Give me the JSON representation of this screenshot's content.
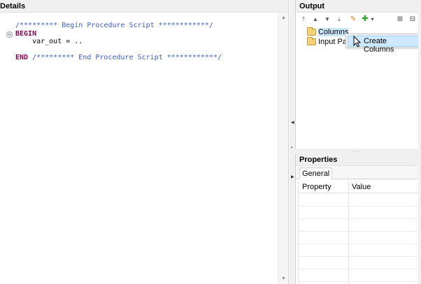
{
  "details": {
    "title": "Details",
    "code": {
      "line1": "/********* Begin Procedure Script ************/",
      "line2": "BEGIN",
      "line3": "    var_out = ..",
      "line5_keyword": "END",
      "line5_comment": " /********* End Procedure Script ************/"
    },
    "fold_marker": "⊖"
  },
  "output": {
    "title": "Output",
    "toolbar": {
      "top": "⤒",
      "up": "▲",
      "down": "▼",
      "bottom": "⤓",
      "edit": "✎",
      "add": "✚",
      "add_dropdown": "▾",
      "expand_all": "⊞",
      "collapse_all": "⊟"
    },
    "tree": [
      {
        "label": "Columns",
        "icon": "folder-open-icon",
        "selected": true
      },
      {
        "label": "Input Para",
        "icon": "folder-open-icon",
        "selected": false
      }
    ],
    "context_menu": {
      "items": [
        {
          "label": "Create Columns",
          "highlighted": true
        }
      ]
    }
  },
  "properties": {
    "title": "Properties",
    "tabs": [
      {
        "label": "General"
      }
    ],
    "columns": {
      "property": "Property",
      "value": "Value"
    }
  },
  "colors": {
    "comment": "#3f5fbf",
    "keyword": "#7f0055",
    "selection": "#cce8ff",
    "add_icon": "#3aa33a",
    "edit_icon": "#d97a16"
  }
}
